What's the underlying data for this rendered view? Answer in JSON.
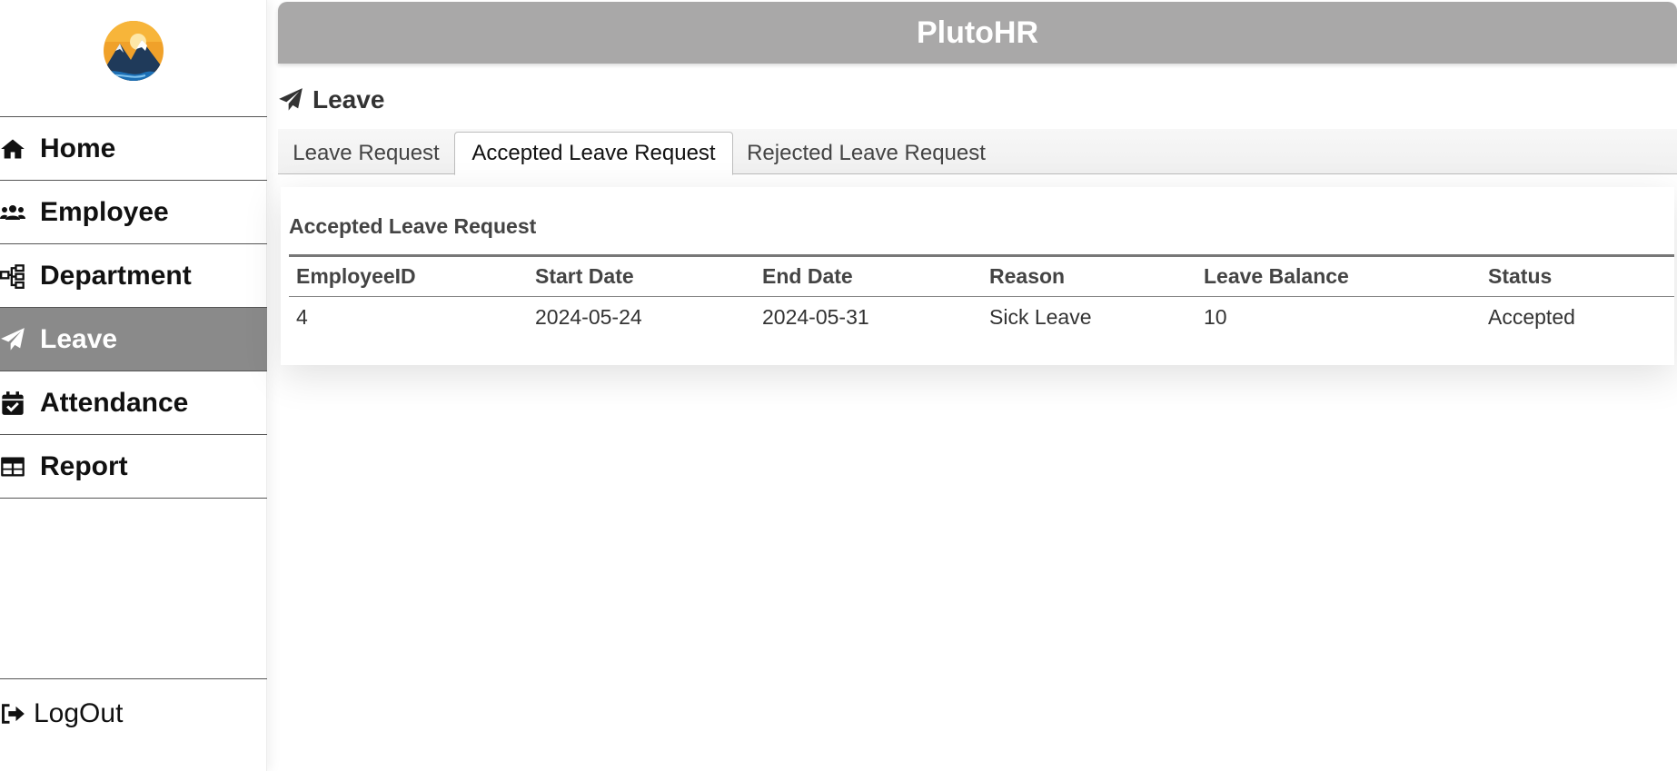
{
  "app": {
    "title": "PlutoHR"
  },
  "sidebar": {
    "items": [
      {
        "label": "Home",
        "icon": "home-icon"
      },
      {
        "label": "Employee",
        "icon": "users-icon"
      },
      {
        "label": "Department",
        "icon": "sitemap-icon"
      },
      {
        "label": "Leave",
        "icon": "paper-plane-icon",
        "active": true
      },
      {
        "label": "Attendance",
        "icon": "calendar-check-icon"
      },
      {
        "label": "Report",
        "icon": "table-icon"
      }
    ],
    "logout": {
      "label": "LogOut",
      "icon": "sign-out-icon"
    }
  },
  "page": {
    "title": "Leave",
    "icon": "paper-plane-icon"
  },
  "tabs": [
    {
      "label": "Leave Request",
      "active": false
    },
    {
      "label": "Accepted Leave Request",
      "active": true
    },
    {
      "label": "Rejected Leave Request",
      "active": false
    }
  ],
  "panel": {
    "title": "Accepted Leave Request",
    "columns": [
      "EmployeeID",
      "Start Date",
      "End Date",
      "Reason",
      "Leave Balance",
      "Status"
    ],
    "rows": [
      [
        "4",
        "2024-05-24",
        "2024-05-31",
        "Sick Leave",
        "10",
        "Accepted"
      ]
    ]
  },
  "colors": {
    "header_bg": "#a9a8a8",
    "active_nav_bg": "#8a8a8a",
    "header_text": "#ffffff"
  }
}
